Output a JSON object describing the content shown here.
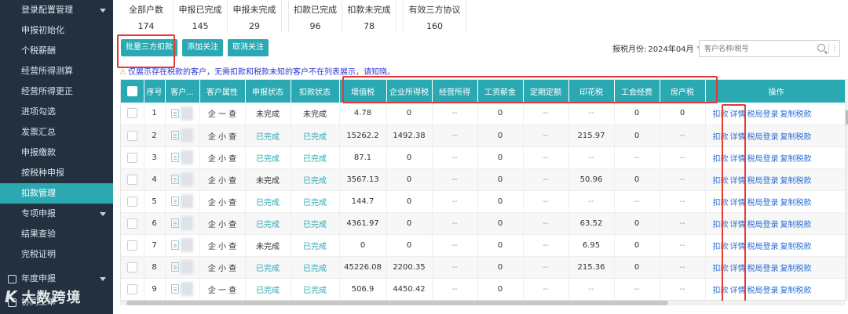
{
  "sidebar": {
    "items": [
      {
        "label": "登录配置管理",
        "caret": true,
        "active": false
      },
      {
        "label": "申报初始化",
        "caret": false,
        "active": false
      },
      {
        "label": "个税薪酬",
        "caret": false,
        "active": false
      },
      {
        "label": "经营所得测算",
        "caret": false,
        "active": false
      },
      {
        "label": "经营所得更正",
        "caret": false,
        "active": false
      },
      {
        "label": "进项勾选",
        "caret": false,
        "active": false
      },
      {
        "label": "发票汇总",
        "caret": false,
        "active": false
      },
      {
        "label": "申报缴款",
        "caret": false,
        "active": false
      },
      {
        "label": "按税种申报",
        "caret": false,
        "active": false
      },
      {
        "label": "扣款管理",
        "caret": false,
        "active": true
      },
      {
        "label": "专项申报",
        "caret": true,
        "active": false
      },
      {
        "label": "结果查验",
        "caret": false,
        "active": false
      },
      {
        "label": "完税证明",
        "caret": false,
        "active": false
      },
      {
        "label": "年度申报",
        "caret": true,
        "active": false,
        "icon": true
      },
      {
        "label": "协同工单",
        "caret": false,
        "active": false,
        "icon": true
      }
    ],
    "brand": {
      "mark": "K",
      "text": "大数跨境"
    }
  },
  "stats": [
    {
      "label": "全部户数",
      "value": "174"
    },
    {
      "label": "申报已完成",
      "value": "145"
    },
    {
      "label": "申报未完成",
      "value": "29"
    },
    {
      "label": "扣款已完成",
      "value": "96"
    },
    {
      "label": "扣款未完成",
      "value": "78"
    },
    {
      "label": "有效三方协议",
      "value": "160"
    }
  ],
  "toolbar": {
    "batch_label": "批量三方扣款",
    "follow_label": "添加关注",
    "unfollow_label": "取消关注"
  },
  "filter": {
    "month_label": "报税月份:",
    "month_value": "2024年04月",
    "search_placeholder": "客户名称/税号"
  },
  "notice": "仅展示存在税款的客户，无需扣款和税款未知的客户不在列表展示，请知晓。",
  "table": {
    "headers": [
      "",
      "序号",
      "客户...",
      "客户属性",
      "申报状态",
      "扣款状态",
      "增值税",
      "企业所得税",
      "经营所得",
      "工资薪金",
      "定期定额",
      "印花税",
      "工会经费",
      "房产税",
      "操作"
    ],
    "rows": [
      {
        "idx": "1",
        "attr": "企 一 查",
        "decl": "未完成",
        "deduct": "未完成",
        "vat": "4.78",
        "cit": "0",
        "biz": "--",
        "wage": "0",
        "fixed": "--",
        "stamp": "--",
        "union": "0",
        "prop": "0"
      },
      {
        "idx": "2",
        "attr": "企 小 查",
        "decl": "已完成",
        "deduct": "已完成",
        "vat": "15262.2",
        "cit": "1492.38",
        "biz": "--",
        "wage": "0",
        "fixed": "--",
        "stamp": "215.97",
        "union": "0",
        "prop": "--"
      },
      {
        "idx": "3",
        "attr": "企 小 查",
        "decl": "已完成",
        "deduct": "已完成",
        "vat": "87.1",
        "cit": "0",
        "biz": "--",
        "wage": "0",
        "fixed": "--",
        "stamp": "--",
        "union": "--",
        "prop": "--"
      },
      {
        "idx": "4",
        "attr": "企 小 查",
        "decl": "未完成",
        "deduct": "已完成",
        "vat": "3567.13",
        "cit": "0",
        "biz": "--",
        "wage": "0",
        "fixed": "--",
        "stamp": "50.96",
        "union": "0",
        "prop": "--"
      },
      {
        "idx": "5",
        "attr": "企 小 查",
        "decl": "已完成",
        "deduct": "已完成",
        "vat": "144.7",
        "cit": "0",
        "biz": "--",
        "wage": "0",
        "fixed": "--",
        "stamp": "--",
        "union": "--",
        "prop": "--"
      },
      {
        "idx": "6",
        "attr": "企 小 查",
        "decl": "已完成",
        "deduct": "已完成",
        "vat": "4361.97",
        "cit": "0",
        "biz": "--",
        "wage": "0",
        "fixed": "--",
        "stamp": "63.52",
        "union": "0",
        "prop": "--"
      },
      {
        "idx": "7",
        "attr": "企 小 查",
        "decl": "未完成",
        "deduct": "已完成",
        "vat": "0",
        "cit": "0",
        "biz": "--",
        "wage": "0",
        "fixed": "--",
        "stamp": "6.95",
        "union": "0",
        "prop": "--"
      },
      {
        "idx": "8",
        "attr": "企 小 查",
        "decl": "已完成",
        "deduct": "已完成",
        "vat": "45226.08",
        "cit": "2200.35",
        "biz": "--",
        "wage": "0",
        "fixed": "--",
        "stamp": "215.36",
        "union": "0",
        "prop": "--"
      },
      {
        "idx": "9",
        "attr": "企 一 查",
        "decl": "已完成",
        "deduct": "已完成",
        "vat": "506.9",
        "cit": "4450.42",
        "biz": "--",
        "wage": "0",
        "fixed": "--",
        "stamp": "--",
        "union": "--",
        "prop": "--"
      }
    ],
    "actions": [
      "扣款",
      "详情",
      "税局登录",
      "复制税款"
    ]
  },
  "colors": {
    "accent": "#2aa9b2",
    "sidebar": "#23303f",
    "highlight": "#e53935",
    "link": "#2a6fd4"
  }
}
